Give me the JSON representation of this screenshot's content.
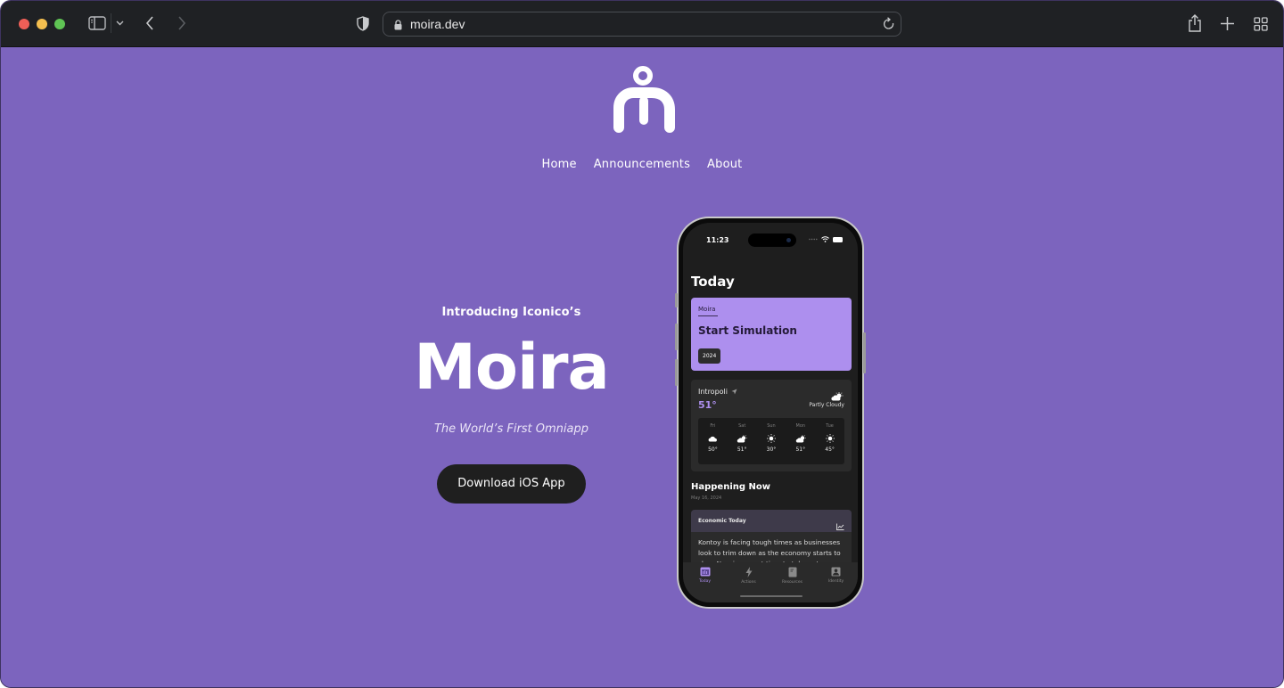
{
  "browser": {
    "url": "moira.dev",
    "icons": {
      "sidebar": "sidebar-icon",
      "chevron": "chevron-down-icon",
      "back": "back-arrow-icon",
      "forward": "forward-arrow-icon",
      "privacy": "shield-icon",
      "lock": "lock-icon",
      "reload": "reload-icon",
      "share": "share-icon",
      "new_tab": "plus-icon",
      "tabs": "tab-overview-icon"
    }
  },
  "site": {
    "brand_color": "#7c64be",
    "accent_color": "#ad8fee",
    "logo": "moira-logo",
    "nav": [
      {
        "label": "Home"
      },
      {
        "label": "Announcements"
      },
      {
        "label": "About"
      }
    ],
    "hero": {
      "intro": "Introducing Iconico’s",
      "title": "Moira",
      "tagline": "The World’s First Omniapp",
      "cta": "Download iOS App"
    }
  },
  "phone": {
    "status_time": "11:23",
    "screen_title": "Today",
    "sim_card": {
      "brand": "Moira",
      "action": "Start Simulation",
      "year": "2024"
    },
    "weather": {
      "city": "Intropoli",
      "temp": "51°",
      "condition": "Partly Cloudy",
      "forecast": [
        {
          "day": "Fri",
          "icon": "cloud",
          "temp": "50°"
        },
        {
          "day": "Sat",
          "icon": "partly-cloudy",
          "temp": "51°"
        },
        {
          "day": "Sun",
          "icon": "sun",
          "temp": "30°"
        },
        {
          "day": "Mon",
          "icon": "partly-cloudy",
          "temp": "51°"
        },
        {
          "day": "Tue",
          "icon": "sun",
          "temp": "45°"
        }
      ]
    },
    "happening": {
      "title": "Happening Now",
      "date": "May 16, 2024",
      "news_title": "Economic Today",
      "news_body": "Kontoy is facing tough times as businesses look to trim down as the economy starts to slow. Now is a great time to take out a"
    },
    "tabs": [
      {
        "label": "Today",
        "icon": "calendar",
        "active": true
      },
      {
        "label": "Actions",
        "icon": "bolt",
        "active": false
      },
      {
        "label": "Resources",
        "icon": "document",
        "active": false
      },
      {
        "label": "Identity",
        "icon": "person-badge",
        "active": false
      }
    ]
  }
}
